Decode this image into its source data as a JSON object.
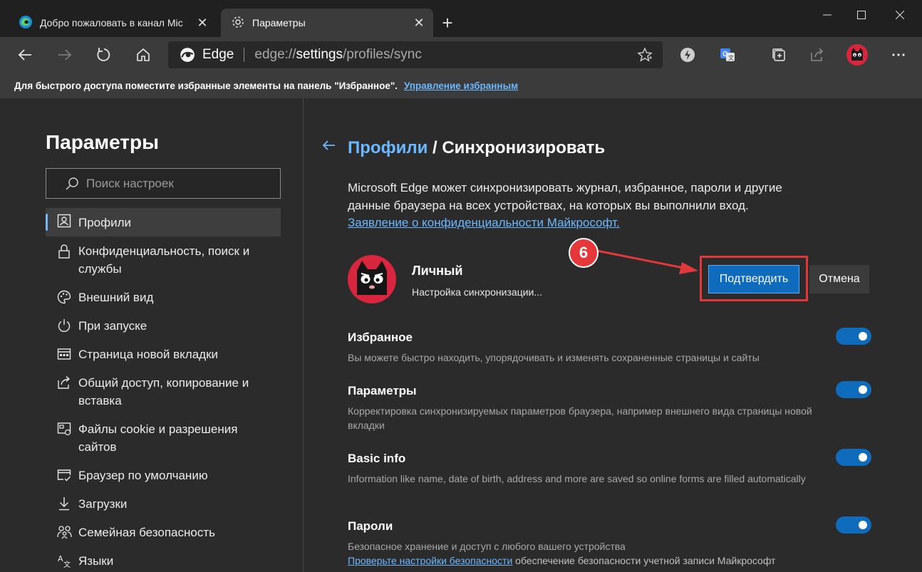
{
  "tabs": [
    {
      "title": "Добро пожаловать в канал Mic",
      "active": false
    },
    {
      "title": "Параметры",
      "active": true
    }
  ],
  "toolbar": {
    "address_brand": "Edge",
    "address_url_prefix": "edge://",
    "address_url_bold": "settings",
    "address_url_suffix": "/profiles/sync"
  },
  "favorites_bar": {
    "message": "Для быстрого доступа поместите избранные элементы на панель \"Избранное\".",
    "link": "Управление избранным"
  },
  "sidebar": {
    "title": "Параметры",
    "search_placeholder": "Поиск настроек",
    "items": [
      {
        "label": "Профили",
        "icon": "profile-icon",
        "selected": true
      },
      {
        "label": "Конфиденциальность, поиск и службы",
        "icon": "lock-icon"
      },
      {
        "label": "Внешний вид",
        "icon": "palette-icon"
      },
      {
        "label": "При запуске",
        "icon": "power-icon"
      },
      {
        "label": "Страница новой вкладки",
        "icon": "new-tab-page-icon"
      },
      {
        "label": "Общий доступ, копирование и вставка",
        "icon": "share-icon"
      },
      {
        "label": "Файлы cookie и разрешения сайтов",
        "icon": "cookie-permissions-icon"
      },
      {
        "label": "Браузер по умолчанию",
        "icon": "default-browser-icon"
      },
      {
        "label": "Загрузки",
        "icon": "download-icon"
      },
      {
        "label": "Семейная безопасность",
        "icon": "family-icon"
      },
      {
        "label": "Языки",
        "icon": "language-icon"
      }
    ]
  },
  "main": {
    "breadcrumb_link": "Профили",
    "breadcrumb_sep": " / ",
    "breadcrumb_current": "Синхронизировать",
    "description": "Microsoft Edge может синхронизировать журнал, избранное, пароли и другие данные браузера на всех устройствах, на которых вы выполнили вход. ",
    "description_link": "Заявление о конфиденциальности Майкрософт.",
    "account_name": "Личный",
    "account_status": "Настройка синхронизации...",
    "confirm_label": "Подтвердить",
    "cancel_label": "Отмена",
    "step_number": "6",
    "sync_items": [
      {
        "title": "Избранное",
        "description": "Вы можете быстро находить, упорядочивать и изменять сохраненные страницы и сайты",
        "enabled": true
      },
      {
        "title": "Параметры",
        "description": "Корректировка синхронизируемых параметров браузера, например внешнего вида страницы новой вкладки",
        "enabled": true
      },
      {
        "title": "Basic info",
        "description": "Information like name, date of birth, address and more are saved so online forms are filled automatically",
        "enabled": true
      },
      {
        "title": "Пароли",
        "description": "Безопасное хранение и доступ с любого вашего устройства",
        "link": "Проверьте настройки безопасности",
        "tail": " обеспечение безопасности учетной записи Майкрософт",
        "enabled": true
      }
    ]
  },
  "colors": {
    "accent": "#0f6cbd",
    "link": "#6cb8ff",
    "highlight_red": "#e1383b"
  }
}
